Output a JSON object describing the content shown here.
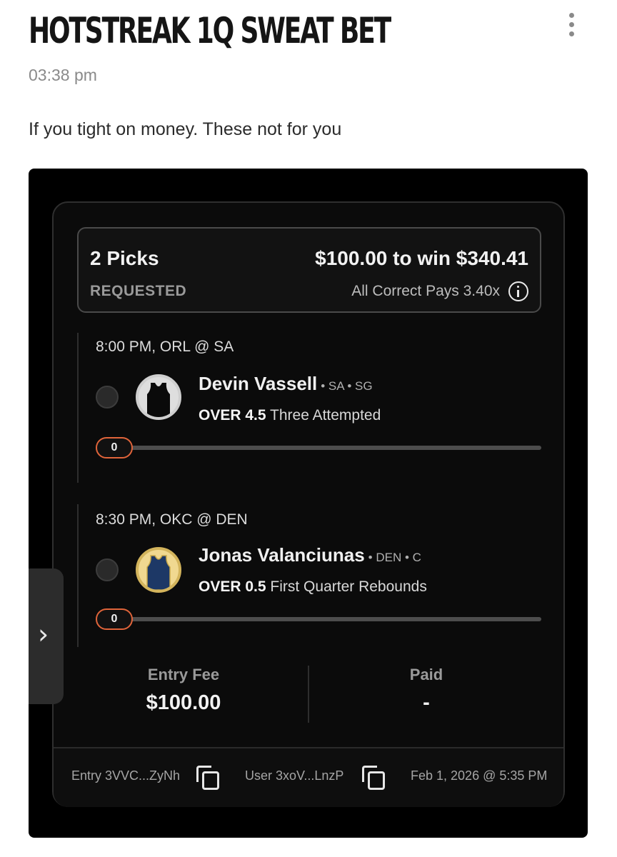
{
  "post": {
    "title": "HOTSTREAK 1Q SWEAT BET",
    "time": "03:38 pm",
    "caption": "If you tight on money. These not for you"
  },
  "icons": {
    "more": "more-vertical-icon",
    "info": "info-icon",
    "copy": "copy-icon",
    "chevron": "chevron-right-icon"
  },
  "bet": {
    "picks_label": "2 Picks",
    "status": "REQUESTED",
    "amount": "$100.00 to win $340.41",
    "pays": "All Correct Pays 3.40x"
  },
  "picks": [
    {
      "game": "8:00 PM, ORL @ SA",
      "player": "Devin Vassell",
      "meta": "• SA • SG",
      "direction": "OVER",
      "line": "4.5",
      "stat": "Three Attempted",
      "progress": "0",
      "jersey_color": "#000000"
    },
    {
      "game": "8:30 PM, OKC @ DEN",
      "player": "Jonas Valanciunas",
      "meta": "• DEN • C",
      "direction": "OVER",
      "line": "0.5",
      "stat": "First Quarter Rebounds",
      "progress": "0",
      "jersey_color": "#1d3866"
    }
  ],
  "fees": {
    "entry_label": "Entry Fee",
    "entry_value": "$100.00",
    "paid_label": "Paid",
    "paid_value": "-"
  },
  "footer": {
    "entry_id": "Entry 3VVC...ZyNh",
    "user_id": "User 3xoV...LnzP",
    "date": "Feb 1, 2026 @ 5:35 PM"
  },
  "colors": {
    "accent": "#e0643a",
    "card_bg": "#0b0b0b"
  }
}
